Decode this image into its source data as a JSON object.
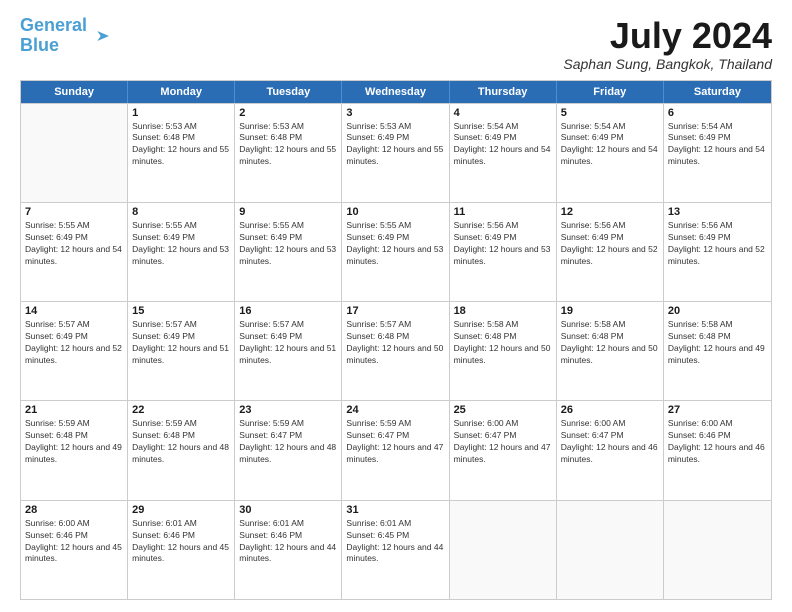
{
  "logo": {
    "general": "General",
    "blue": "Blue",
    "tagline": ""
  },
  "header": {
    "month_title": "July 2024",
    "location": "Saphan Sung, Bangkok, Thailand"
  },
  "weekdays": [
    "Sunday",
    "Monday",
    "Tuesday",
    "Wednesday",
    "Thursday",
    "Friday",
    "Saturday"
  ],
  "weeks": [
    [
      {
        "day": "",
        "empty": true
      },
      {
        "day": "1",
        "sunrise": "5:53 AM",
        "sunset": "6:48 PM",
        "daylight": "12 hours and 55 minutes."
      },
      {
        "day": "2",
        "sunrise": "5:53 AM",
        "sunset": "6:48 PM",
        "daylight": "12 hours and 55 minutes."
      },
      {
        "day": "3",
        "sunrise": "5:53 AM",
        "sunset": "6:49 PM",
        "daylight": "12 hours and 55 minutes."
      },
      {
        "day": "4",
        "sunrise": "5:54 AM",
        "sunset": "6:49 PM",
        "daylight": "12 hours and 54 minutes."
      },
      {
        "day": "5",
        "sunrise": "5:54 AM",
        "sunset": "6:49 PM",
        "daylight": "12 hours and 54 minutes."
      },
      {
        "day": "6",
        "sunrise": "5:54 AM",
        "sunset": "6:49 PM",
        "daylight": "12 hours and 54 minutes."
      }
    ],
    [
      {
        "day": "7",
        "sunrise": "5:55 AM",
        "sunset": "6:49 PM",
        "daylight": "12 hours and 54 minutes."
      },
      {
        "day": "8",
        "sunrise": "5:55 AM",
        "sunset": "6:49 PM",
        "daylight": "12 hours and 53 minutes."
      },
      {
        "day": "9",
        "sunrise": "5:55 AM",
        "sunset": "6:49 PM",
        "daylight": "12 hours and 53 minutes."
      },
      {
        "day": "10",
        "sunrise": "5:55 AM",
        "sunset": "6:49 PM",
        "daylight": "12 hours and 53 minutes."
      },
      {
        "day": "11",
        "sunrise": "5:56 AM",
        "sunset": "6:49 PM",
        "daylight": "12 hours and 53 minutes."
      },
      {
        "day": "12",
        "sunrise": "5:56 AM",
        "sunset": "6:49 PM",
        "daylight": "12 hours and 52 minutes."
      },
      {
        "day": "13",
        "sunrise": "5:56 AM",
        "sunset": "6:49 PM",
        "daylight": "12 hours and 52 minutes."
      }
    ],
    [
      {
        "day": "14",
        "sunrise": "5:57 AM",
        "sunset": "6:49 PM",
        "daylight": "12 hours and 52 minutes."
      },
      {
        "day": "15",
        "sunrise": "5:57 AM",
        "sunset": "6:49 PM",
        "daylight": "12 hours and 51 minutes."
      },
      {
        "day": "16",
        "sunrise": "5:57 AM",
        "sunset": "6:49 PM",
        "daylight": "12 hours and 51 minutes."
      },
      {
        "day": "17",
        "sunrise": "5:57 AM",
        "sunset": "6:48 PM",
        "daylight": "12 hours and 50 minutes."
      },
      {
        "day": "18",
        "sunrise": "5:58 AM",
        "sunset": "6:48 PM",
        "daylight": "12 hours and 50 minutes."
      },
      {
        "day": "19",
        "sunrise": "5:58 AM",
        "sunset": "6:48 PM",
        "daylight": "12 hours and 50 minutes."
      },
      {
        "day": "20",
        "sunrise": "5:58 AM",
        "sunset": "6:48 PM",
        "daylight": "12 hours and 49 minutes."
      }
    ],
    [
      {
        "day": "21",
        "sunrise": "5:59 AM",
        "sunset": "6:48 PM",
        "daylight": "12 hours and 49 minutes."
      },
      {
        "day": "22",
        "sunrise": "5:59 AM",
        "sunset": "6:48 PM",
        "daylight": "12 hours and 48 minutes."
      },
      {
        "day": "23",
        "sunrise": "5:59 AM",
        "sunset": "6:47 PM",
        "daylight": "12 hours and 48 minutes."
      },
      {
        "day": "24",
        "sunrise": "5:59 AM",
        "sunset": "6:47 PM",
        "daylight": "12 hours and 47 minutes."
      },
      {
        "day": "25",
        "sunrise": "6:00 AM",
        "sunset": "6:47 PM",
        "daylight": "12 hours and 47 minutes."
      },
      {
        "day": "26",
        "sunrise": "6:00 AM",
        "sunset": "6:47 PM",
        "daylight": "12 hours and 46 minutes."
      },
      {
        "day": "27",
        "sunrise": "6:00 AM",
        "sunset": "6:46 PM",
        "daylight": "12 hours and 46 minutes."
      }
    ],
    [
      {
        "day": "28",
        "sunrise": "6:00 AM",
        "sunset": "6:46 PM",
        "daylight": "12 hours and 45 minutes."
      },
      {
        "day": "29",
        "sunrise": "6:01 AM",
        "sunset": "6:46 PM",
        "daylight": "12 hours and 45 minutes."
      },
      {
        "day": "30",
        "sunrise": "6:01 AM",
        "sunset": "6:46 PM",
        "daylight": "12 hours and 44 minutes."
      },
      {
        "day": "31",
        "sunrise": "6:01 AM",
        "sunset": "6:45 PM",
        "daylight": "12 hours and 44 minutes."
      },
      {
        "day": "",
        "empty": true
      },
      {
        "day": "",
        "empty": true
      },
      {
        "day": "",
        "empty": true
      }
    ]
  ]
}
